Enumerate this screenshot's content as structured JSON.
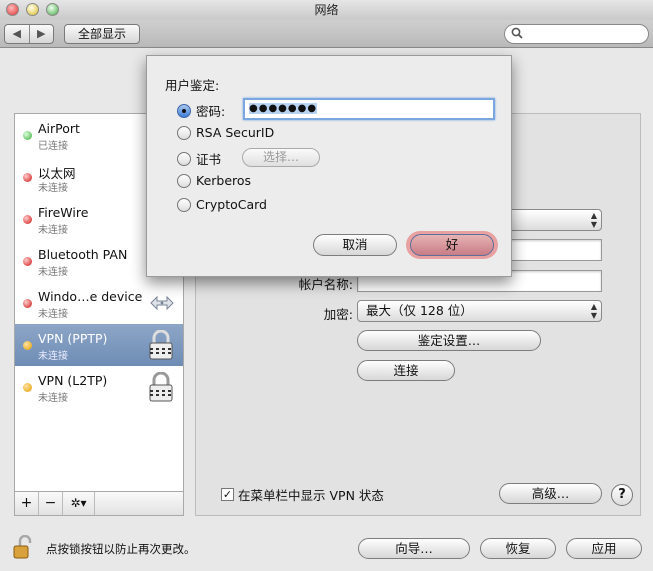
{
  "window": {
    "title": "网络"
  },
  "toolbar": {
    "back": "◀",
    "forward": "▶",
    "show_all": "全部显示",
    "search_placeholder": ""
  },
  "sidebar": {
    "services": [
      {
        "name": "AirPort",
        "status": "已连接",
        "dot": "green"
      },
      {
        "name": "以太网",
        "status": "未连接",
        "dot": "red"
      },
      {
        "name": "FireWire",
        "status": "未连接",
        "dot": "red"
      },
      {
        "name": "Bluetooth PAN",
        "status": "未连接",
        "dot": "red"
      },
      {
        "name": "Windo…e device",
        "status": "未连接",
        "dot": "red",
        "icon": "arrows-icon"
      },
      {
        "name": "VPN (PPTP)",
        "status": "未连接",
        "dot": "orange",
        "icon": "vpn-lock-icon",
        "selected": true
      },
      {
        "name": "VPN (L2TP)",
        "status": "未连接",
        "dot": "orange",
        "icon": "vpn-lock-icon"
      }
    ],
    "footer": {
      "add": "+",
      "remove": "−",
      "action": "✲▾"
    }
  },
  "detail": {
    "account_label": "帐户名称:",
    "account_value": "",
    "encryption_label": "加密:",
    "encryption_value": "最大（仅 128 位）",
    "auth_settings_button": "鉴定设置…",
    "connect_button": "连接",
    "show_vpn_status_label": "在菜单栏中显示 VPN 状态",
    "show_vpn_status_checked": true,
    "advanced_button": "高级…",
    "help_button": "?"
  },
  "sheet": {
    "title": "用户鉴定:",
    "options": [
      {
        "label": "密码:",
        "selected": true
      },
      {
        "label": "RSA SecurID",
        "selected": false
      },
      {
        "label": "证书",
        "selected": false
      },
      {
        "label": "Kerberos",
        "selected": false
      },
      {
        "label": "CryptoCard",
        "selected": false
      }
    ],
    "password_value": "●●●●●●●",
    "choose_button": "选择…",
    "cancel_button": "取消",
    "ok_button": "好"
  },
  "bottom": {
    "lock_text": "点按锁按钮以防止再次更改。",
    "assist_button": "向导…",
    "revert_button": "恢复",
    "apply_button": "应用"
  },
  "colors": {
    "selection": "#7b96bd",
    "ok_highlight": "#e8a0a0",
    "focus_ring": "#7aa7e0"
  }
}
